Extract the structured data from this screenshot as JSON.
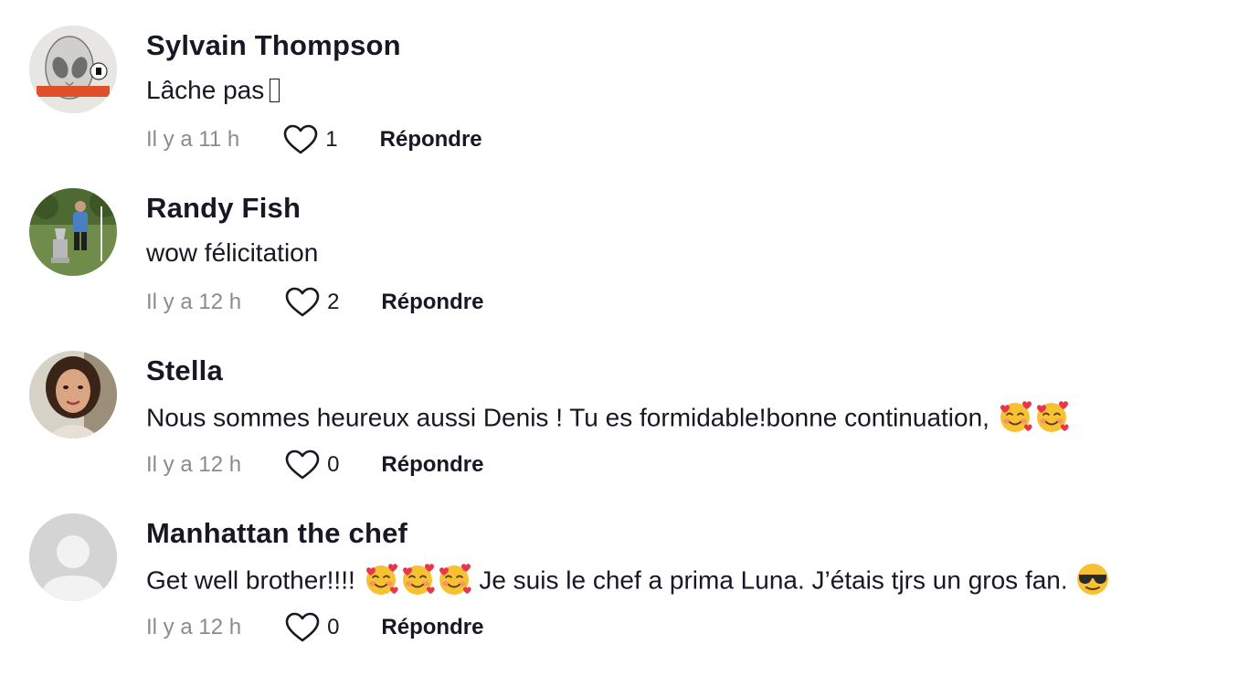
{
  "comments": [
    {
      "username": "Sylvain Thompson",
      "text": "Lâche pas",
      "text_suffix_glyph": "unrendered-glyph",
      "time": "Il y a 11 h",
      "likes": "1",
      "reply_label": "Répondre",
      "avatar": "alien-sketch-avatar"
    },
    {
      "username": "Randy Fish",
      "text": "wow félicitation",
      "time": "Il y a 12 h",
      "likes": "2",
      "reply_label": "Répondre",
      "avatar": "golf-course-photo-avatar"
    },
    {
      "username": "Stella",
      "text": "Nous sommes heureux aussi Denis ! Tu es formidable!bonne continuation,",
      "emojis": [
        "smiling-face-with-hearts",
        "smiling-face-with-hearts"
      ],
      "time": "Il y a 12 h",
      "likes": "0",
      "reply_label": "Répondre",
      "avatar": "woman-portrait-avatar"
    },
    {
      "username": "Manhattan the chef",
      "text_part1": "Get well brother!!!!",
      "emojis_part1": [
        "smiling-face-with-hearts",
        "smiling-face-with-hearts",
        "smiling-face-with-hearts"
      ],
      "text_part2": "Je suis le chef a prima Luna. J’étais tjrs un gros fan.",
      "emojis_part2": [
        "smiling-face-with-sunglasses"
      ],
      "time": "Il y a 12 h",
      "likes": "0",
      "reply_label": "Répondre",
      "avatar": "default-user-avatar"
    }
  ],
  "colors": {
    "text": "#161823",
    "meta": "#8a8b91",
    "background": "#ffffff"
  }
}
